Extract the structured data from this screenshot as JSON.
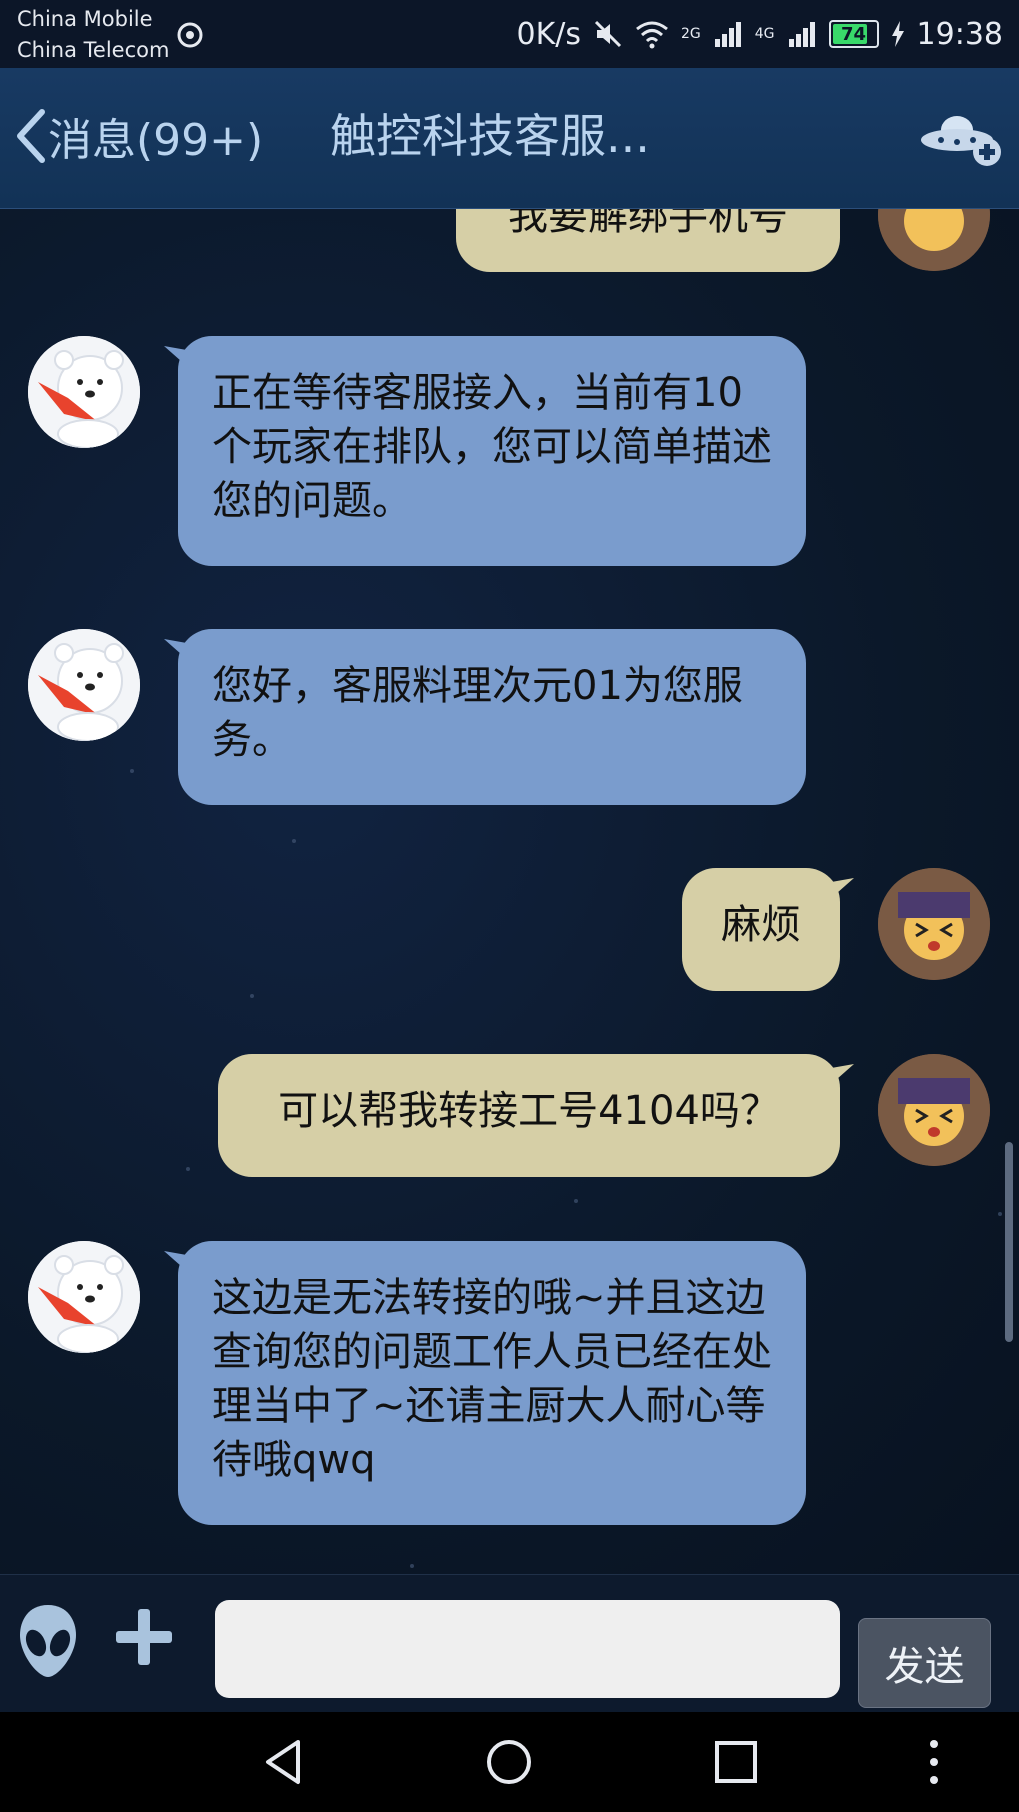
{
  "status": {
    "carrier1": "China Mobile",
    "carrier2": "China Telecom",
    "speed": "0K/s",
    "sig2g": "2G",
    "sig4g": "4G",
    "battery": "74",
    "time": "19:38"
  },
  "header": {
    "back_label": "消息(99+)",
    "title": "触控科技客服..."
  },
  "messages": [
    {
      "side": "out",
      "text": "我要解绑手机号"
    },
    {
      "side": "in",
      "text": "正在等待客服接入，当前有10个玩家在排队，您可以简单描述您的问题。"
    },
    {
      "side": "in",
      "text": "您好，客服料理次元01为您服务。"
    },
    {
      "side": "out",
      "text": "麻烦"
    },
    {
      "side": "out",
      "text": "可以帮我转接工号4104吗？"
    },
    {
      "side": "in",
      "text": "这边是无法转接的哦~并且这边查询您的问题工作人员已经在处理当中了~还请主厨大人耐心等待哦qwq"
    }
  ],
  "input": {
    "value": "",
    "send_label": "发送"
  },
  "icons": {
    "back": "chevron-left-icon",
    "ufo": "ufo-add-icon",
    "emoji": "alien-icon",
    "plus": "plus-icon",
    "nav_back": "triangle-back-icon",
    "nav_home": "circle-home-icon",
    "nav_recent": "square-recent-icon",
    "nav_menu": "dots-menu-icon"
  },
  "colors": {
    "incoming_bubble": "#7a9ccd",
    "outgoing_bubble": "#d6cfa6",
    "header_bg": "#163760",
    "battery_fill": "#39d96a"
  }
}
